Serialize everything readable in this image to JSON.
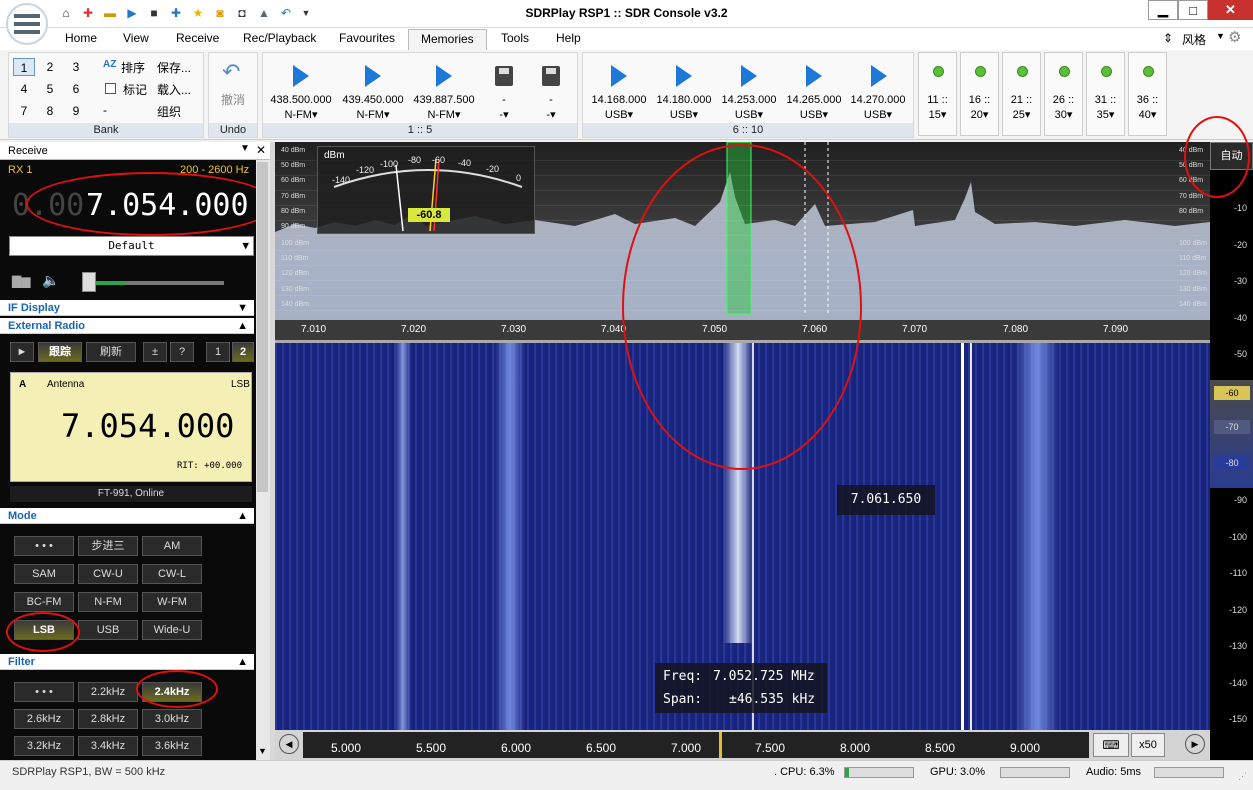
{
  "window": {
    "title": "SDRPlay RSP1 :: SDR Console v3.2"
  },
  "menu": [
    "Home",
    "View",
    "Receive",
    "Rec/Playback",
    "Favourites",
    "Memories",
    "Tools",
    "Help"
  ],
  "menu_right": "风格",
  "ribbon": {
    "bank": {
      "keys": [
        "1",
        "2",
        "3",
        "4",
        "5",
        "6",
        "7",
        "8",
        "9"
      ],
      "sort": "排序",
      "save": "保存...",
      "mark": "标记",
      "load": "载入...",
      "dash": "-",
      "organize": "组织",
      "label": "Bank"
    },
    "undo": {
      "label_btn": "撤消",
      "label": "Undo"
    },
    "mem1": {
      "items": [
        {
          "freq": "438.500.000",
          "mode": "N-FM"
        },
        {
          "freq": "439.450.000",
          "mode": "N-FM"
        },
        {
          "freq": "439.887.500",
          "mode": "N-FM"
        },
        {
          "freq": "-",
          "mode": "-"
        },
        {
          "freq": "-",
          "mode": "-"
        }
      ],
      "label": "1 :: 5"
    },
    "mem2": {
      "items": [
        {
          "freq": "14.168.000",
          "mode": "USB"
        },
        {
          "freq": "14.180.000",
          "mode": "USB"
        },
        {
          "freq": "14.253.000",
          "mode": "USB"
        },
        {
          "freq": "14.265.000",
          "mode": "USB"
        },
        {
          "freq": "14.270.000",
          "mode": "USB"
        }
      ],
      "label": "6 :: 10"
    },
    "pages": [
      {
        "a": "11 ::",
        "b": "15"
      },
      {
        "a": "16 ::",
        "b": "20"
      },
      {
        "a": "21 ::",
        "b": "25"
      },
      {
        "a": "26 ::",
        "b": "30"
      },
      {
        "a": "31 ::",
        "b": "35"
      },
      {
        "a": "36 ::",
        "b": "40"
      }
    ]
  },
  "receive": {
    "header": "Receive",
    "rx": "RX 1",
    "bw": "200 - 2600 Hz",
    "freq_dim": "0.00",
    "freq": "7.054.000",
    "preset": "Default"
  },
  "sections": {
    "if_display": "IF Display",
    "external_radio": "External Radio",
    "mode": "Mode",
    "filter": "Filter"
  },
  "extradio": {
    "btns": [
      "►",
      "跟踪",
      "刷新",
      "±",
      "?",
      "1",
      "2"
    ],
    "antenna_a": "A",
    "antenna": "Antenna",
    "mode": "LSB",
    "freq": "7.054.000",
    "rit": "RIT: +00.000",
    "status": "FT-991, Online"
  },
  "modes": [
    "• • •",
    "步进三",
    "AM",
    "SAM",
    "CW-U",
    "CW-L",
    "BC-FM",
    "N-FM",
    "W-FM",
    "LSB",
    "USB",
    "Wide-U"
  ],
  "filters": [
    "• • •",
    "2.2kHz",
    "2.4kHz",
    "2.6kHz",
    "2.8kHz",
    "3.0kHz",
    "3.2kHz",
    "3.4kHz",
    "3.6kHz"
  ],
  "spectrum": {
    "db_left": [
      "40 dBm",
      "50 dBm",
      "60 dBm",
      "70 dBm",
      "80 dBm",
      "90 dBm",
      "100 dBm",
      "110 dBm",
      "120 dBm",
      "130 dBm",
      "140 dBm"
    ],
    "db_right": [
      "40 dBm",
      "50 dBm",
      "60 dBm",
      "70 dBm",
      "80 dBm",
      "100 dBm",
      "110 dBm",
      "120 dBm",
      "130 dBm",
      "140 dBm"
    ],
    "freqs": [
      "7.010",
      "7.020",
      "7.030",
      "7.040",
      "7.050",
      "7.060",
      "7.070",
      "7.080",
      "7.090"
    ],
    "meter": {
      "label": "dBm",
      "ticks": [
        "-140",
        "-120",
        "-100",
        "-80",
        "-60",
        "-40",
        "-20",
        "0"
      ],
      "value": "-60.8"
    },
    "auto": "自动"
  },
  "waterfall": {
    "cursor_freq": "7.061.650",
    "freq_label": "Freq:",
    "freq_value": "7.052.725 MHz",
    "span_label": "Span:",
    "span_value": "±46.535 kHz",
    "ticks": [
      "5.000",
      "5.500",
      "6.000",
      "6.500",
      "7.000",
      "7.500",
      "8.000",
      "8.500",
      "9.000"
    ],
    "zoom": "x50"
  },
  "scale": [
    "-10",
    "-20",
    "-30",
    "-40",
    "-50",
    "-60",
    "-70",
    "-80",
    "-90",
    "-100",
    "-110",
    "-120",
    "-130",
    "-140",
    "-150"
  ],
  "status": {
    "device": "SDRPlay RSP1, BW = 500 kHz",
    "cpu": ". CPU: 6.3%",
    "gpu": "GPU: 3.0%",
    "audio": "Audio: 5ms"
  }
}
